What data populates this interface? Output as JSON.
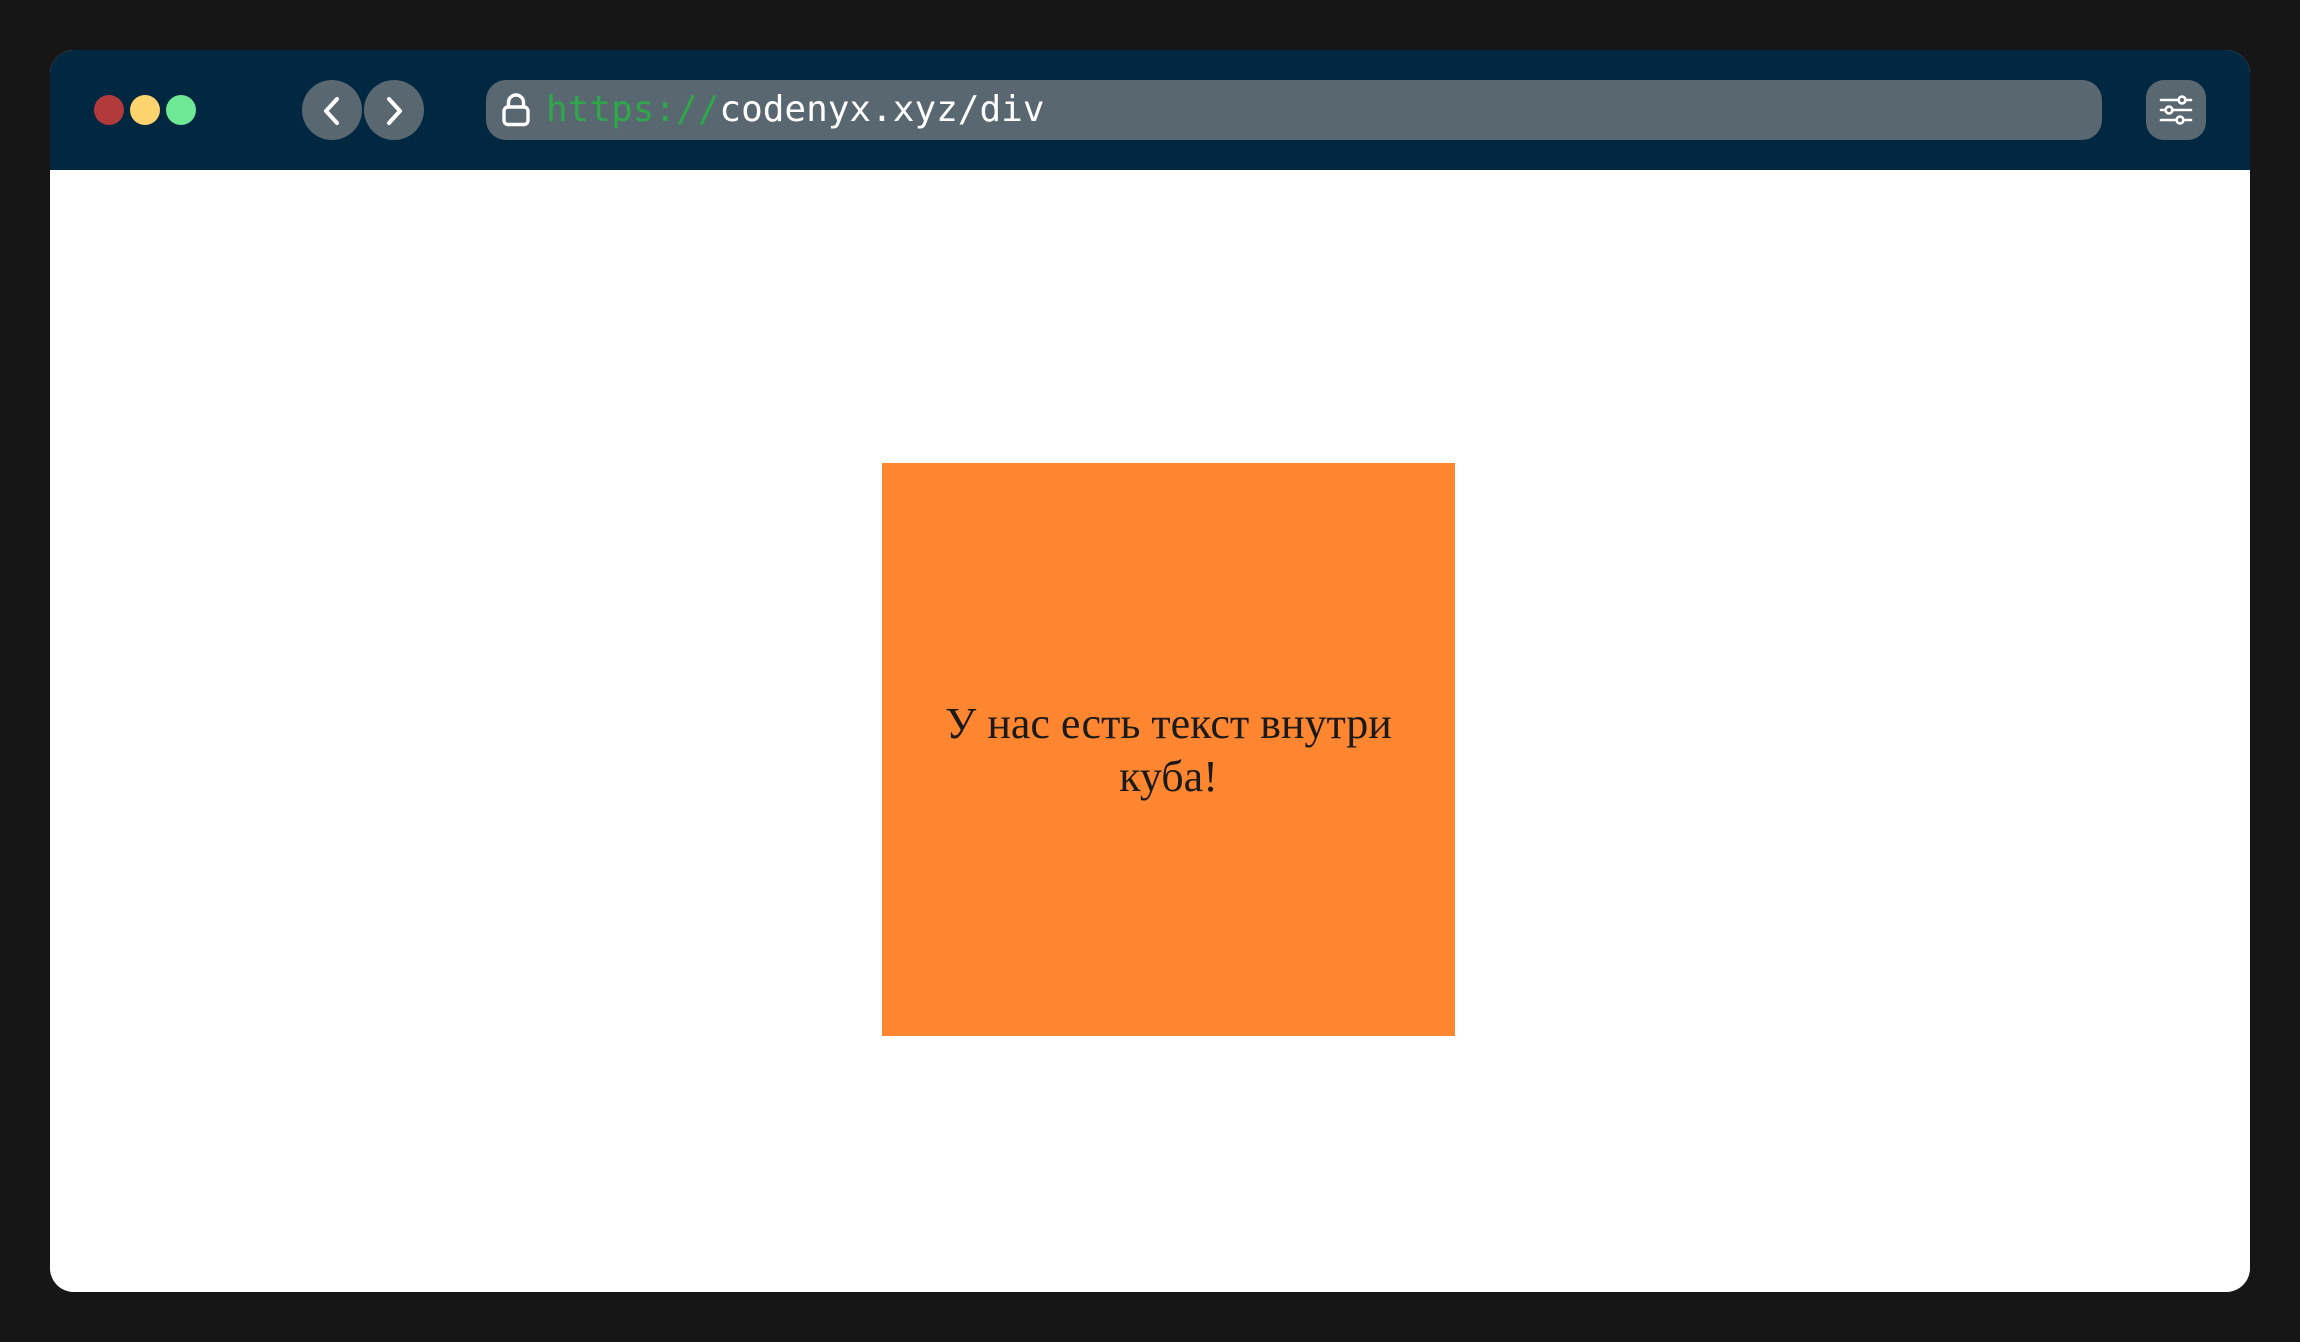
{
  "browser": {
    "frame_background": "#161616",
    "toolbar_color": "#022741",
    "control_color": "#586770",
    "traffic_lights": {
      "close_color": "#b33a3a",
      "minimize_color": "#ffd46e",
      "maximize_color": "#6ee895"
    },
    "back_icon": "chevron-left-icon",
    "forward_icon": "chevron-right-icon",
    "address": {
      "lock_icon": "lock-icon",
      "scheme": "https://",
      "scheme_color": "#2ea84a",
      "host_path": "codenyx.xyz/div",
      "host_path_color": "#ffffff"
    },
    "settings_icon": "sliders-icon"
  },
  "page": {
    "background": "#ffffff",
    "cube": {
      "color": "#ff8630",
      "text": "У нас есть текст внутри куба!"
    }
  }
}
